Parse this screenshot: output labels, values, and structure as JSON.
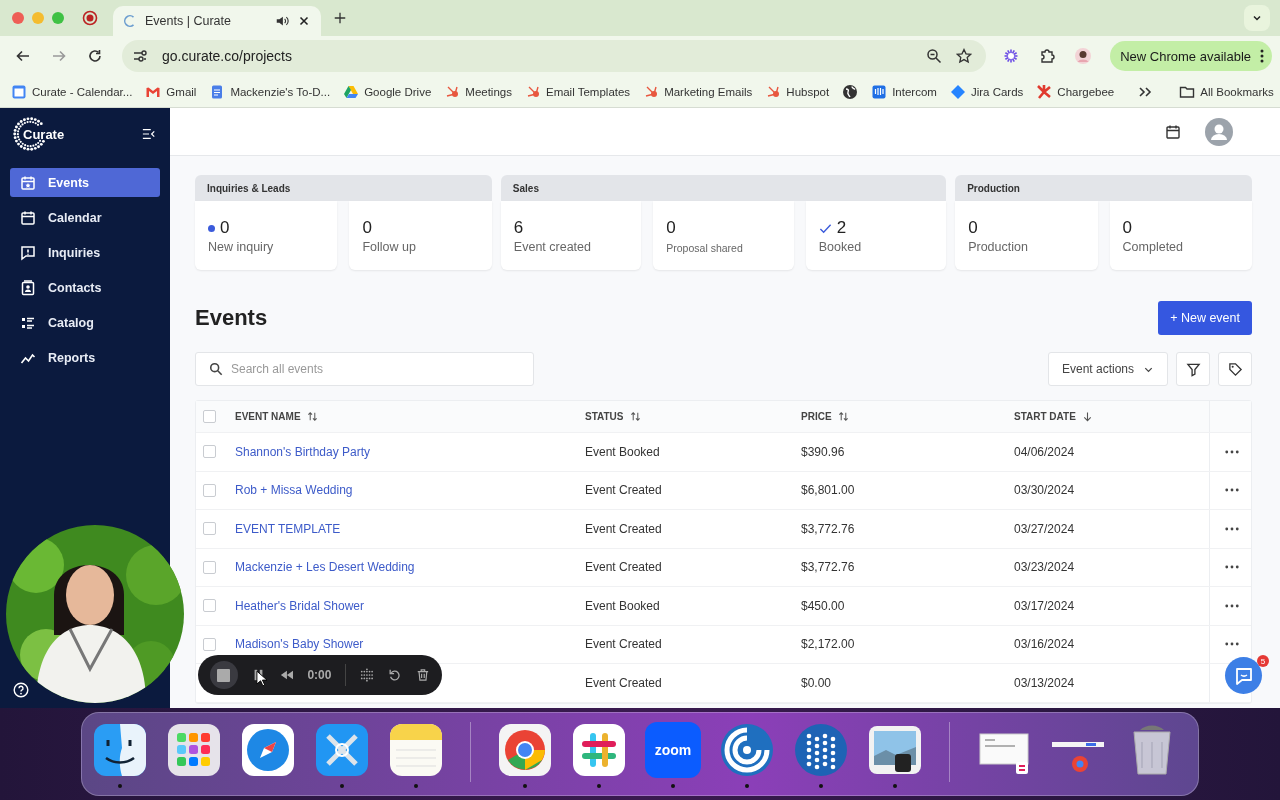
{
  "browser": {
    "tabs": [
      {
        "title": "Events | Curate",
        "selected": true
      }
    ],
    "address": "go.curate.co/projects",
    "update_button": "New Chrome available",
    "bookmarks": [
      {
        "kind": "calendar",
        "label": "Curate - Calendar..."
      },
      {
        "kind": "mail",
        "label": "Gmail"
      },
      {
        "kind": "doc",
        "label": "Mackenzie's To-D..."
      },
      {
        "kind": "drive",
        "label": "Google Drive"
      },
      {
        "kind": "sprocket",
        "label": "Meetings"
      },
      {
        "kind": "sprocket",
        "label": "Email Templates"
      },
      {
        "kind": "sprocket",
        "label": "Marketing Emails"
      },
      {
        "kind": "sprocket",
        "label": "Hubspot"
      },
      {
        "kind": "globe"
      },
      {
        "kind": "bars",
        "label": "Intercom"
      },
      {
        "kind": "diamond",
        "label": "Jira Cards"
      },
      {
        "kind": "burst",
        "label": "Chargebee"
      }
    ],
    "all_bookmarks": "All Bookmarks"
  },
  "sidebar": {
    "brand": "Curate",
    "items": [
      {
        "kind": "events",
        "label": "Events",
        "selected": true
      },
      {
        "kind": "calendar",
        "label": "Calendar",
        "selected": false
      },
      {
        "kind": "inquiries",
        "label": "Inquiries",
        "selected": false
      },
      {
        "kind": "contacts",
        "label": "Contacts",
        "selected": false
      },
      {
        "kind": "catalog",
        "label": "Catalog",
        "selected": false
      },
      {
        "kind": "reports",
        "label": "Reports",
        "selected": false
      }
    ]
  },
  "stat_groups": [
    {
      "title": "Inquiries & Leads",
      "cards": [
        {
          "kind": "dot",
          "value": "0",
          "label": "New inquiry"
        },
        {
          "kind": "plain",
          "value": "0",
          "label": "Follow up"
        }
      ]
    },
    {
      "title": "Sales",
      "cards": [
        {
          "kind": "plain",
          "value": "6",
          "label": "Event created"
        },
        {
          "kind": "small",
          "value": "0",
          "label": "Proposal shared"
        },
        {
          "kind": "check",
          "value": "2",
          "label": "Booked"
        }
      ]
    },
    {
      "title": "Production",
      "cards": [
        {
          "kind": "plain",
          "value": "0",
          "label": "Production"
        },
        {
          "kind": "plain",
          "value": "0",
          "label": "Completed"
        }
      ]
    }
  ],
  "events": {
    "title": "Events",
    "new_button": "+ New event",
    "search_placeholder": "Search all events",
    "actions_button": "Event actions",
    "select_all_checked": false,
    "columns": [
      {
        "kind": "sortable",
        "label": "EVENT NAME"
      },
      {
        "kind": "sortable",
        "label": "STATUS"
      },
      {
        "kind": "sortable",
        "label": "PRICE"
      },
      {
        "kind": "sorted",
        "label": "START DATE"
      }
    ],
    "rows": [
      {
        "checked": false,
        "name": "Shannon's Birthday Party",
        "status": "Event Booked",
        "price": "$390.96",
        "date": "04/06/2024"
      },
      {
        "checked": false,
        "name": "Rob + Missa Wedding",
        "status": "Event Created",
        "price": "$6,801.00",
        "date": "03/30/2024"
      },
      {
        "checked": false,
        "name": "EVENT TEMPLATE",
        "status": "Event Created",
        "price": "$3,772.76",
        "date": "03/27/2024"
      },
      {
        "checked": false,
        "name": "Mackenzie + Les Desert Wedding",
        "status": "Event Created",
        "price": "$3,772.76",
        "date": "03/23/2024"
      },
      {
        "checked": false,
        "name": "Heather's Bridal Shower",
        "status": "Event Booked",
        "price": "$450.00",
        "date": "03/17/2024"
      },
      {
        "checked": false,
        "name": "Madison's Baby Shower",
        "status": "Event Created",
        "price": "$2,172.00",
        "date": "03/16/2024"
      },
      {
        "status": "Event Created",
        "price": "$0.00",
        "date": "03/13/2024"
      }
    ]
  },
  "recorder": {
    "time": "0:00"
  },
  "chat": {
    "badge": "5"
  },
  "dock": {
    "apps": [
      {
        "kind": "finder",
        "running": true
      },
      {
        "kind": "launchpad",
        "running": false
      },
      {
        "kind": "safari",
        "running": false
      },
      {
        "kind": "wrench",
        "running": true
      },
      {
        "kind": "notes",
        "running": true
      },
      {
        "kind": "separator"
      },
      {
        "kind": "chrome",
        "running": true
      },
      {
        "kind": "slack",
        "running": true
      },
      {
        "kind": "zoom",
        "label": "zoom",
        "running": true
      },
      {
        "kind": "rings",
        "running": true
      },
      {
        "kind": "dots",
        "running": true
      },
      {
        "kind": "preview",
        "running": true
      },
      {
        "kind": "separator"
      },
      {
        "kind": "window",
        "running": false
      },
      {
        "kind": "window-small",
        "running": false
      },
      {
        "kind": "trash",
        "running": false
      }
    ]
  }
}
